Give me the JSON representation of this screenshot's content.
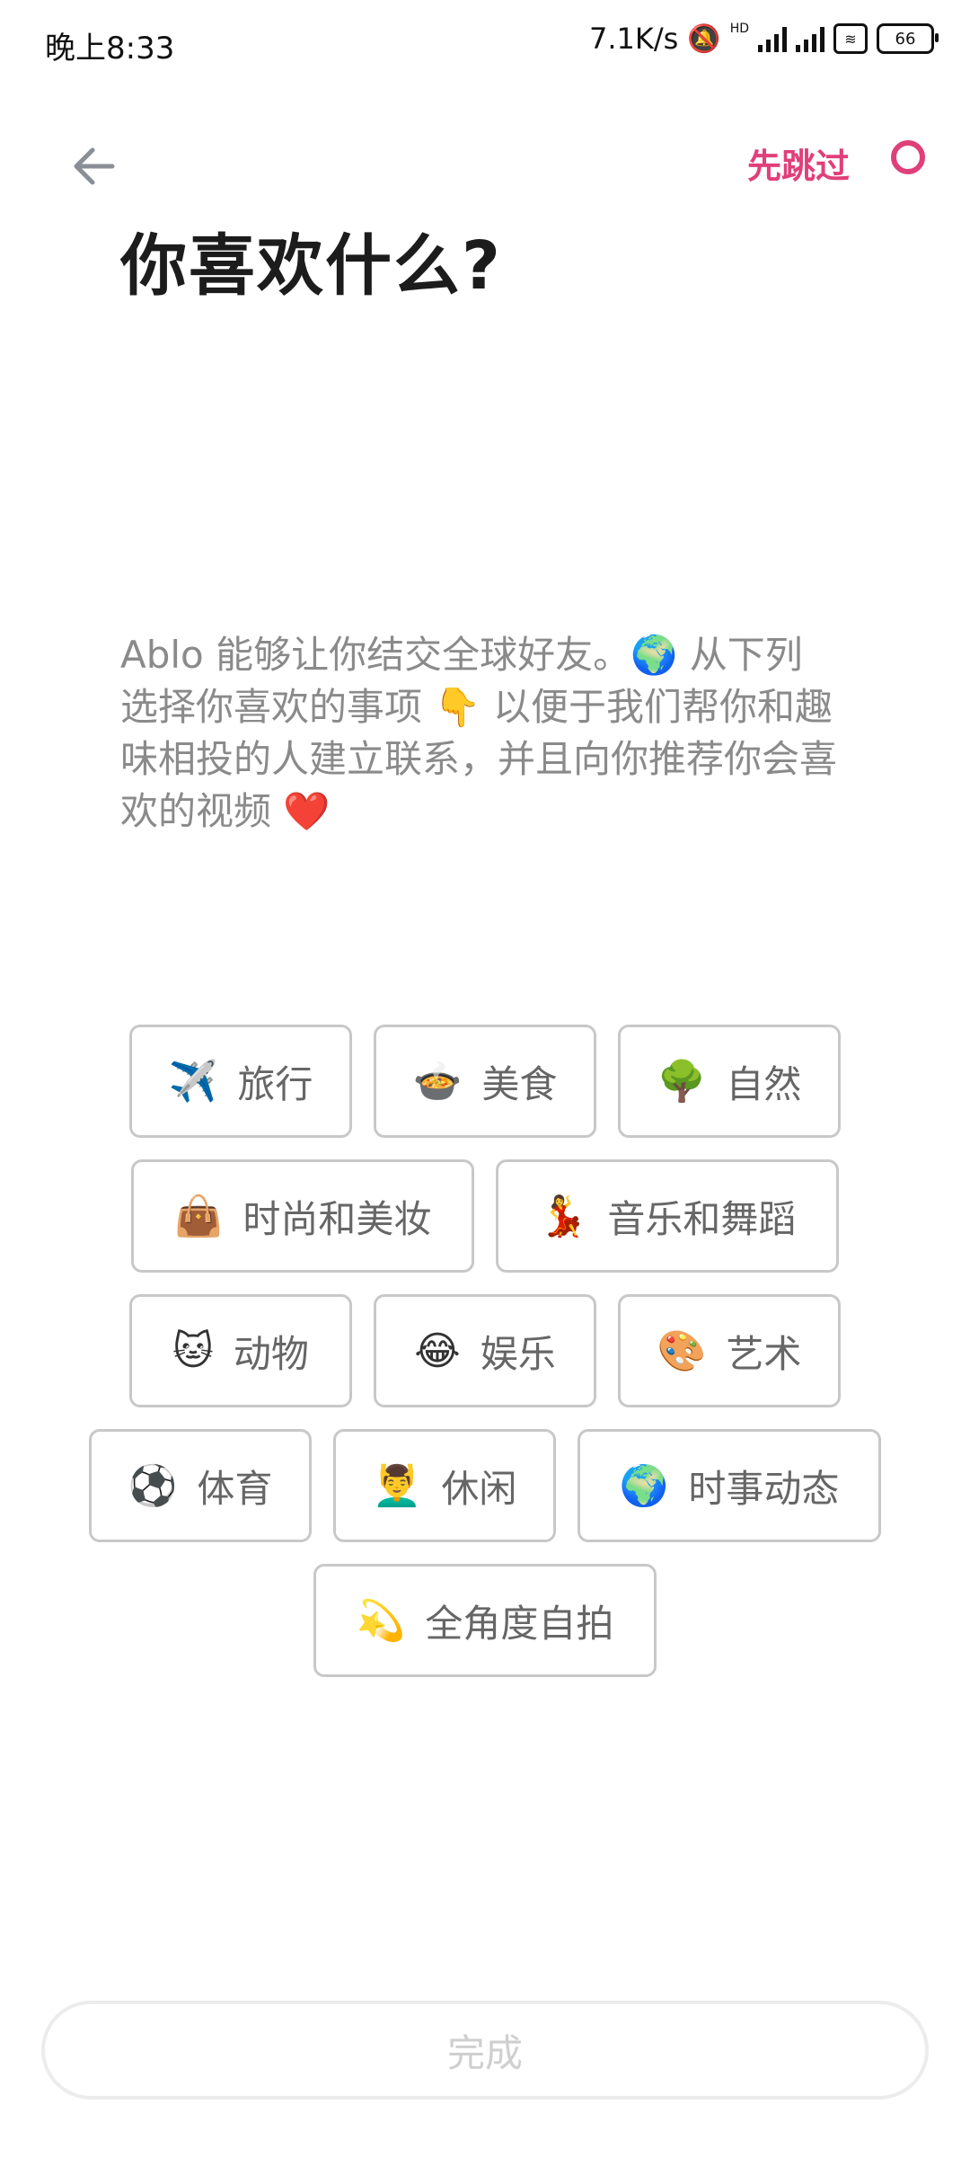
{
  "status_bar": {
    "time": "晚上8:33",
    "network_speed": "7.1K/s",
    "hd_label": "HD",
    "battery_level": "66"
  },
  "header": {
    "skip_label": "先跳过",
    "title": "你喜欢什么?"
  },
  "description": "Ablo 能够让你结交全球好友。🌍 从下列选择你喜欢的事项 👇 以便于我们帮你和趣味相投的人建立联系，并且向你推荐你会喜欢的视频 ❤️",
  "interests": [
    {
      "emoji": "✈️",
      "label": "旅行"
    },
    {
      "emoji": "🍲",
      "label": "美食"
    },
    {
      "emoji": "🌳",
      "label": "自然"
    },
    {
      "emoji": "👜",
      "label": "时尚和美妆"
    },
    {
      "emoji": "💃",
      "label": "音乐和舞蹈"
    },
    {
      "emoji": "🐱",
      "label": "动物"
    },
    {
      "emoji": "😂",
      "label": "娱乐"
    },
    {
      "emoji": "🎨",
      "label": "艺术"
    },
    {
      "emoji": "⚽",
      "label": "体育"
    },
    {
      "emoji": "💆‍♂️",
      "label": "休闲"
    },
    {
      "emoji": "🌍",
      "label": "时事动态"
    },
    {
      "emoji": "💫",
      "label": "全角度自拍"
    }
  ],
  "done_label": "完成",
  "colors": {
    "accent": "#e0407a",
    "chip_border": "#c8c8c8",
    "disabled_text": "#cfcfcf"
  }
}
